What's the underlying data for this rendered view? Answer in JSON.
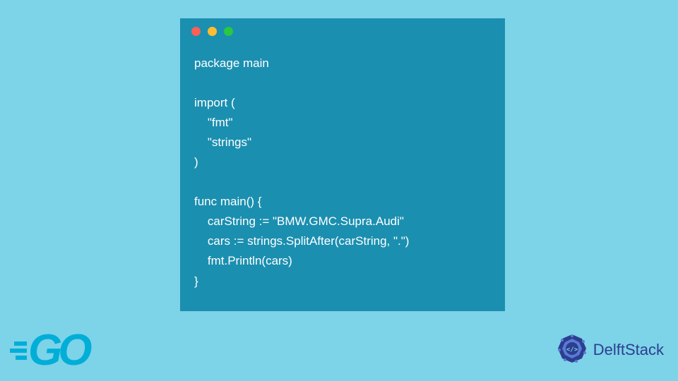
{
  "code": {
    "lines": [
      "package main",
      "",
      "import (",
      "    \"fmt\"",
      "    \"strings\"",
      ")",
      "",
      "func main() {",
      "    carString := \"BMW.GMC.Supra.Audi\"",
      "    cars := strings.SplitAfter(carString, \".\")",
      "    fmt.Println(cars)",
      "}"
    ]
  },
  "logos": {
    "go": "GO",
    "delft": "DelftStack"
  },
  "colors": {
    "background": "#7dd3e8",
    "window": "#1b8fb0",
    "code_text": "#ffffff",
    "go_brand": "#00aed8",
    "delft_brand": "#2c3e8f"
  }
}
